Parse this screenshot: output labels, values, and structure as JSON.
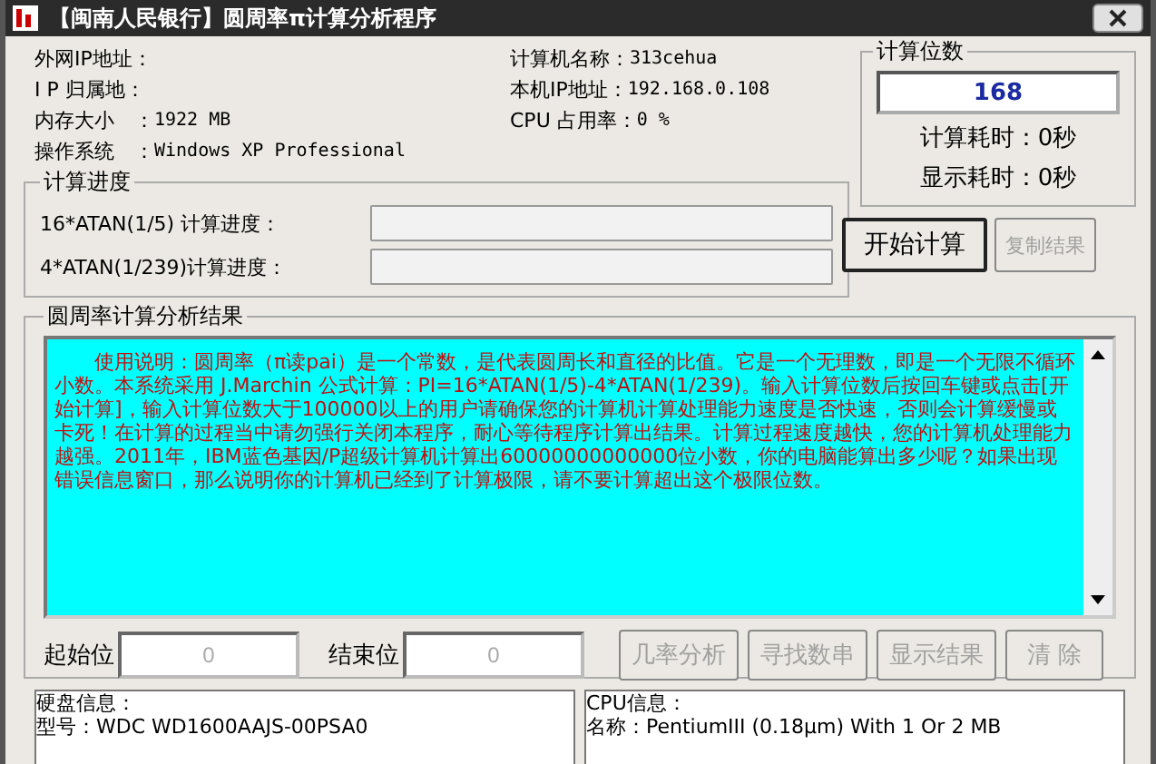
{
  "window": {
    "title": "【闽南人民银行】圆周率π计算分析程序"
  },
  "system_info": [
    {
      "label": "外网IP地址："
    },
    {
      "label": "I P 归属地："
    },
    {
      "label": "内存大小　：",
      "value": "1922 MB"
    },
    {
      "label": "操作系统　：",
      "value": "Windows XP Professional"
    }
  ],
  "machine_info": [
    {
      "label": "计算机名称：",
      "value": "313cehua"
    },
    {
      "label": "本机IP地址：",
      "value": "192.168.0.108"
    },
    {
      "label": "CPU 占用率：",
      "value": "0 %"
    }
  ],
  "progress": {
    "title": "计算进度",
    "bars": [
      {
        "label": "16*ATAN(1/5) 计算进度：",
        "level": 0
      },
      {
        "label": "4*ATAN(1/239)计算进度：",
        "level": 0
      }
    ]
  },
  "digits": {
    "title": "计算位数",
    "value": "168",
    "calc_time": "计算耗时：0秒",
    "display_time": "显示耗时：0秒"
  },
  "actions": [
    {
      "label": "开始计算",
      "disabled": false
    },
    {
      "label": "复制结果",
      "disabled": true
    }
  ],
  "result": {
    "title": "圆周率计算分析结果",
    "text": "　　使用说明：圆周率（π读pai）是一个常数，是代表圆周长和直径的比值。它是一个无理数，即是一个无限不循环小数。本系统采用 J.Marchin 公式计算：PI=16*ATAN(1/5)-4*ATAN(1/239)。输入计算位数后按回车键或点击[开始计算]，输入计算位数大于100000以上的用户请确保您的计算机计算处理能力速度是否快速，否则会计算缓慢或卡死！在计算的过程当中请勿强行关闭本程序，耐心等待程序计算出结果。计算过程速度越快，您的计算机处理能力越强。2011年，IBM蓝色基因/P超级计算机计算出60000000000000位小数，你的电脑能算出多少呢？如果出现错误信息窗口，那么说明你的计算机已经到了计算极限，请不要计算超出这个极限位数。"
  },
  "range": [
    {
      "label": "起始位",
      "placeholder": "0"
    },
    {
      "label": "结束位",
      "placeholder": "0"
    }
  ],
  "tools": [
    {
      "label": "几率分析",
      "disabled": true
    },
    {
      "label": "寻找数串",
      "disabled": true
    },
    {
      "label": "显示结果",
      "disabled": true
    },
    {
      "label": "清 除",
      "disabled": true
    }
  ],
  "disk_info": [
    "硬盘信息：",
    "型号：WDC WD1600AAJS-00PSA0"
  ],
  "cpu_info": [
    "CPU信息：",
    "名称：PentiumIII (0.18μm) With 1 Or 2 MB"
  ]
}
